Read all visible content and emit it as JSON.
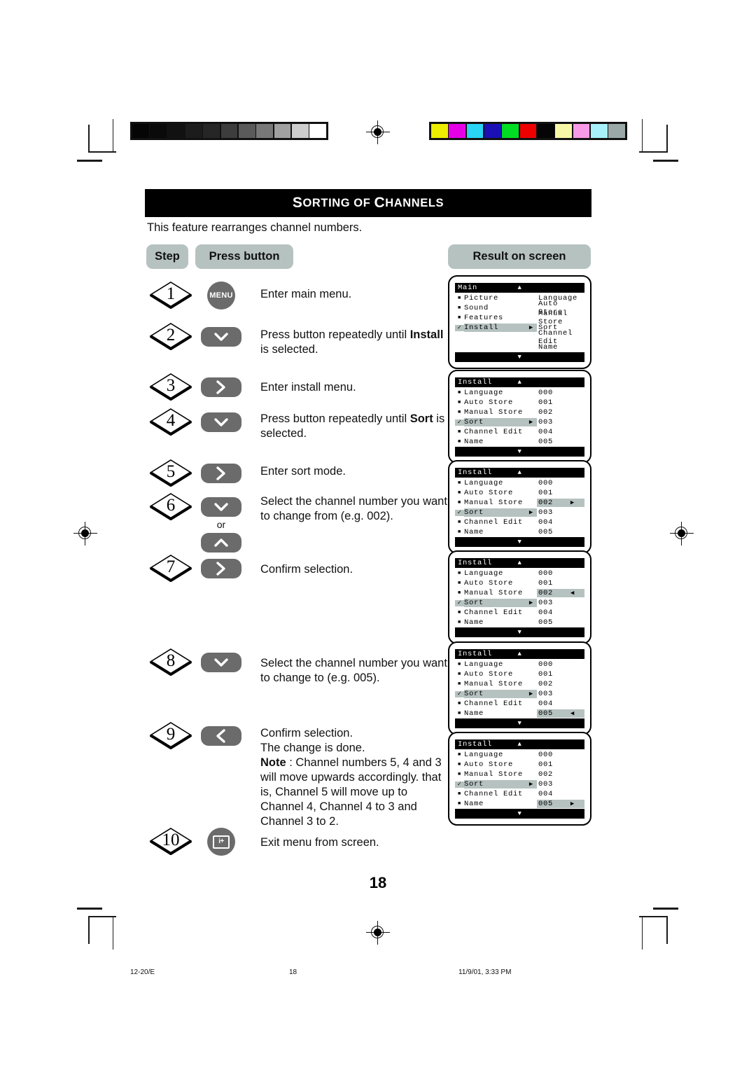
{
  "document": {
    "title_small_1": "S",
    "title": "Sorting of Channels",
    "title_parts": {
      "s": "S",
      "orting": "ORTING",
      "of": "OF",
      "c": "C",
      "hannels": "HANNELS"
    },
    "intro": "This feature rearranges channel numbers.",
    "page_number": "18"
  },
  "headers": {
    "step": "Step",
    "press_button": "Press button",
    "result_on_screen": "Result on screen"
  },
  "steps": [
    {
      "number": "1",
      "button": {
        "type": "round",
        "label": "MENU",
        "icon": "menu-button"
      },
      "description": "Enter main menu.",
      "description_parts": [
        {
          "text": "Enter main menu.",
          "bold": false
        }
      ]
    },
    {
      "number": "2",
      "button": {
        "type": "pill",
        "label": "",
        "icon": "chevron-down-icon"
      },
      "description": "Press button repeatedly until Install is selected.",
      "description_parts": [
        {
          "text": "Press button repeatedly until ",
          "bold": false
        },
        {
          "text": "Install",
          "bold": true
        },
        {
          "text": " is selected.",
          "bold": false
        }
      ]
    },
    {
      "number": "3",
      "button": {
        "type": "pill",
        "label": "",
        "icon": "chevron-right-icon"
      },
      "description": "Enter install menu.",
      "description_parts": [
        {
          "text": "Enter install menu.",
          "bold": false
        }
      ]
    },
    {
      "number": "4",
      "button": {
        "type": "pill",
        "label": "",
        "icon": "chevron-down-icon"
      },
      "description": "Press button repeatedly until Sort is selected.",
      "description_parts": [
        {
          "text": "Press button repeatedly until ",
          "bold": false
        },
        {
          "text": "Sort",
          "bold": true
        },
        {
          "text": " is selected.",
          "bold": false
        }
      ]
    },
    {
      "number": "5",
      "button": {
        "type": "pill",
        "label": "",
        "icon": "chevron-right-icon"
      },
      "description": "Enter sort mode.",
      "description_parts": [
        {
          "text": "Enter sort mode.",
          "bold": false
        }
      ]
    },
    {
      "number": "6",
      "button": {
        "type": "pill-pair",
        "icon": "chevron-down-icon",
        "icon2": "chevron-up-icon",
        "or_label": "or"
      },
      "description": "Select the channel number you want to change from (e.g. 002).",
      "description_parts": [
        {
          "text": "Select the channel number you want to change from (e.g. 002).",
          "bold": false
        }
      ]
    },
    {
      "number": "7",
      "button": {
        "type": "pill",
        "label": "",
        "icon": "chevron-right-icon"
      },
      "description": "Confirm selection.",
      "description_parts": [
        {
          "text": "Confirm selection.",
          "bold": false
        }
      ]
    },
    {
      "number": "8",
      "button": {
        "type": "pill",
        "label": "",
        "icon": "chevron-down-icon"
      },
      "description": "Select the channel number you want to change to (e.g. 005).",
      "description_parts": [
        {
          "text": "Select the channel number you want to change to (e.g. 005).",
          "bold": false
        }
      ]
    },
    {
      "number": "9",
      "button": {
        "type": "pill",
        "label": "",
        "icon": "chevron-left-icon"
      },
      "description": "Confirm selection. The change is done. Note : Channel numbers 5, 4 and 3 will move upwards accordingly. that is, Channel 5 will move up to Channel 4, Channel 4 to 3 and Channel 3 to 2.",
      "description_parts": [
        {
          "text": "Confirm selection.",
          "bold": false,
          "br": true
        },
        {
          "text": "The change is done.",
          "bold": false,
          "br": true
        },
        {
          "text": "Note",
          "bold": true
        },
        {
          "text": " : Channel numbers 5, 4 and 3 will move upwards accordingly. that is, Channel 5 will move up to Channel 4, Channel 4 to 3 and Channel 3 to 2.",
          "bold": false
        }
      ]
    },
    {
      "number": "10",
      "button": {
        "type": "round",
        "label": "i+",
        "icon": "info-button"
      },
      "description": "Exit menu from screen.",
      "description_parts": [
        {
          "text": "Exit menu from screen.",
          "bold": false
        }
      ]
    }
  ],
  "osd_screens": [
    {
      "id": "screen-1-main",
      "title": "Main",
      "up_arrow": "▲",
      "down_arrow": "▼",
      "rows": [
        {
          "bullet": "square",
          "label": "Picture",
          "label_arrow": "",
          "value": "Language",
          "value_arrow": "",
          "highlight_left": false,
          "highlight_value": false
        },
        {
          "bullet": "square",
          "label": "Sound",
          "label_arrow": "",
          "value": "Auto Store",
          "value_arrow": "",
          "highlight_left": false,
          "highlight_value": false
        },
        {
          "bullet": "square",
          "label": "Features",
          "label_arrow": "",
          "value": "Manual Store",
          "value_arrow": "",
          "highlight_left": false,
          "highlight_value": false
        },
        {
          "bullet": "check",
          "label": "Install",
          "label_arrow": "▶",
          "value": "Sort",
          "value_arrow": "",
          "highlight_left": true,
          "highlight_value": false
        },
        {
          "bullet": "none",
          "label": "",
          "label_arrow": "",
          "value": "Channel Edit",
          "value_arrow": "",
          "highlight_left": false,
          "highlight_value": false
        },
        {
          "bullet": "none",
          "label": "",
          "label_arrow": "",
          "value": "Name",
          "value_arrow": "",
          "highlight_left": false,
          "highlight_value": false
        }
      ]
    },
    {
      "id": "screen-2-install",
      "title": "Install",
      "up_arrow": "▲",
      "down_arrow": "▼",
      "rows": [
        {
          "bullet": "square",
          "label": "Language",
          "label_arrow": "",
          "value": "000",
          "value_arrow": "",
          "highlight_left": false,
          "highlight_value": false
        },
        {
          "bullet": "square",
          "label": "Auto Store",
          "label_arrow": "",
          "value": "001",
          "value_arrow": "",
          "highlight_left": false,
          "highlight_value": false
        },
        {
          "bullet": "square",
          "label": "Manual Store",
          "label_arrow": "",
          "value": "002",
          "value_arrow": "",
          "highlight_left": false,
          "highlight_value": false
        },
        {
          "bullet": "check",
          "label": "Sort",
          "label_arrow": "▶",
          "value": "003",
          "value_arrow": "",
          "highlight_left": true,
          "highlight_value": false
        },
        {
          "bullet": "square",
          "label": "Channel Edit",
          "label_arrow": "",
          "value": "004",
          "value_arrow": "",
          "highlight_left": false,
          "highlight_value": false
        },
        {
          "bullet": "square",
          "label": "Name",
          "label_arrow": "",
          "value": "005",
          "value_arrow": "",
          "highlight_left": false,
          "highlight_value": false
        }
      ]
    },
    {
      "id": "screen-3-install-select-from",
      "title": "Install",
      "up_arrow": "▲",
      "down_arrow": "▼",
      "rows": [
        {
          "bullet": "square",
          "label": "Language",
          "label_arrow": "",
          "value": "000",
          "value_arrow": "",
          "highlight_left": false,
          "highlight_value": false
        },
        {
          "bullet": "square",
          "label": "Auto Store",
          "label_arrow": "",
          "value": "001",
          "value_arrow": "",
          "highlight_left": false,
          "highlight_value": false
        },
        {
          "bullet": "square",
          "label": "Manual Store",
          "label_arrow": "",
          "value": "002",
          "value_arrow": "▶",
          "highlight_left": false,
          "highlight_value": true
        },
        {
          "bullet": "check",
          "label": "Sort",
          "label_arrow": "▶",
          "value": "003",
          "value_arrow": "",
          "highlight_left": true,
          "highlight_value": false
        },
        {
          "bullet": "square",
          "label": "Channel Edit",
          "label_arrow": "",
          "value": "004",
          "value_arrow": "",
          "highlight_left": false,
          "highlight_value": false
        },
        {
          "bullet": "square",
          "label": "Name",
          "label_arrow": "",
          "value": "005",
          "value_arrow": "",
          "highlight_left": false,
          "highlight_value": false
        }
      ]
    },
    {
      "id": "screen-4-install-confirm-from",
      "title": "Install",
      "up_arrow": "▲",
      "down_arrow": "▼",
      "rows": [
        {
          "bullet": "square",
          "label": "Language",
          "label_arrow": "",
          "value": "000",
          "value_arrow": "",
          "highlight_left": false,
          "highlight_value": false
        },
        {
          "bullet": "square",
          "label": "Auto Store",
          "label_arrow": "",
          "value": "001",
          "value_arrow": "",
          "highlight_left": false,
          "highlight_value": false
        },
        {
          "bullet": "square",
          "label": "Manual Store",
          "label_arrow": "",
          "value": "002",
          "value_arrow": "◀",
          "highlight_left": false,
          "highlight_value": true
        },
        {
          "bullet": "check",
          "label": "Sort",
          "label_arrow": "▶",
          "value": "003",
          "value_arrow": "",
          "highlight_left": true,
          "highlight_value": false
        },
        {
          "bullet": "square",
          "label": "Channel Edit",
          "label_arrow": "",
          "value": "004",
          "value_arrow": "",
          "highlight_left": false,
          "highlight_value": false
        },
        {
          "bullet": "square",
          "label": "Name",
          "label_arrow": "",
          "value": "005",
          "value_arrow": "",
          "highlight_left": false,
          "highlight_value": false
        }
      ]
    },
    {
      "id": "screen-5-install-select-to",
      "title": "Install",
      "up_arrow": "▲",
      "down_arrow": "▼",
      "rows": [
        {
          "bullet": "square",
          "label": "Language",
          "label_arrow": "",
          "value": "000",
          "value_arrow": "",
          "highlight_left": false,
          "highlight_value": false
        },
        {
          "bullet": "square",
          "label": "Auto Store",
          "label_arrow": "",
          "value": "001",
          "value_arrow": "",
          "highlight_left": false,
          "highlight_value": false
        },
        {
          "bullet": "square",
          "label": "Manual Store",
          "label_arrow": "",
          "value": "002",
          "value_arrow": "",
          "highlight_left": false,
          "highlight_value": false
        },
        {
          "bullet": "check",
          "label": "Sort",
          "label_arrow": "▶",
          "value": "003",
          "value_arrow": "",
          "highlight_left": true,
          "highlight_value": false
        },
        {
          "bullet": "square",
          "label": "Channel Edit",
          "label_arrow": "",
          "value": "004",
          "value_arrow": "",
          "highlight_left": false,
          "highlight_value": false
        },
        {
          "bullet": "square",
          "label": "Name",
          "label_arrow": "",
          "value": "005",
          "value_arrow": "◀",
          "highlight_left": false,
          "highlight_value": true
        }
      ]
    },
    {
      "id": "screen-6-install-done",
      "title": "Install",
      "up_arrow": "▲",
      "down_arrow": "▼",
      "rows": [
        {
          "bullet": "square",
          "label": "Language",
          "label_arrow": "",
          "value": "000",
          "value_arrow": "",
          "highlight_left": false,
          "highlight_value": false
        },
        {
          "bullet": "square",
          "label": "Auto Store",
          "label_arrow": "",
          "value": "001",
          "value_arrow": "",
          "highlight_left": false,
          "highlight_value": false
        },
        {
          "bullet": "square",
          "label": "Manual Store",
          "label_arrow": "",
          "value": "002",
          "value_arrow": "",
          "highlight_left": false,
          "highlight_value": false
        },
        {
          "bullet": "check",
          "label": "Sort",
          "label_arrow": "▶",
          "value": "003",
          "value_arrow": "",
          "highlight_left": true,
          "highlight_value": false
        },
        {
          "bullet": "square",
          "label": "Channel Edit",
          "label_arrow": "",
          "value": "004",
          "value_arrow": "",
          "highlight_left": false,
          "highlight_value": false
        },
        {
          "bullet": "square",
          "label": "Name",
          "label_arrow": "",
          "value": "005",
          "value_arrow": "▶",
          "highlight_left": false,
          "highlight_value": true
        }
      ]
    }
  ],
  "footer": {
    "left": "12-20/E",
    "center": "18",
    "right": "11/9/01, 3:33 PM"
  },
  "calibration": {
    "grayscale": [
      "#050505",
      "#0a0a0a",
      "#111111",
      "#1c1c1c",
      "#262626",
      "#3d3d3d",
      "#5a5a5a",
      "#787878",
      "#a0a0a0",
      "#cdcdcd",
      "#ffffff"
    ],
    "colors": [
      "#eeee00",
      "#e600e6",
      "#2ad4f5",
      "#1a10b5",
      "#00dd22",
      "#ee0000",
      "#050505",
      "#f7f7a8",
      "#f79ae8",
      "#a8f0fb",
      "#9aa8a8"
    ]
  },
  "colors": {
    "pill_bg": "#b6c2c0",
    "button_bg": "#6b6b6b",
    "title_bar_bg": "#000000",
    "osd_highlight": "#b6c2c0"
  }
}
